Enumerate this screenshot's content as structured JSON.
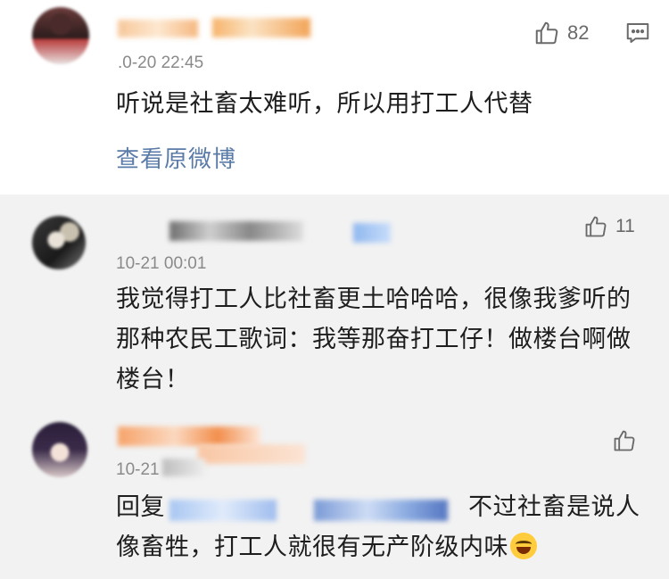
{
  "comments": [
    {
      "timestamp": ".0-20 22:45",
      "text": "听说是社畜太难听，所以用打工人代替",
      "likes": "82",
      "view_original": "查看原微博"
    },
    {
      "timestamp": "10-21 00:01",
      "text": "我觉得打工人比社畜更土哈哈哈，很像我爹听的那种农民工歌词：我等那奋打工仔！做楼台啊做楼台！",
      "likes": "11"
    },
    {
      "timestamp": "10-21",
      "reply_prefix": "回复",
      "text": "不过社畜是说人像畜牲，打工人就很有无产阶级内味",
      "likes": ""
    }
  ],
  "icons": {
    "like": "thumbs-up-icon",
    "comment": "comment-icon",
    "emoji": "laughing-tears-emoji"
  },
  "colors": {
    "link": "#5b7ca8",
    "meta": "#8a8a8a",
    "reply_bg": "#f2f2f2"
  }
}
